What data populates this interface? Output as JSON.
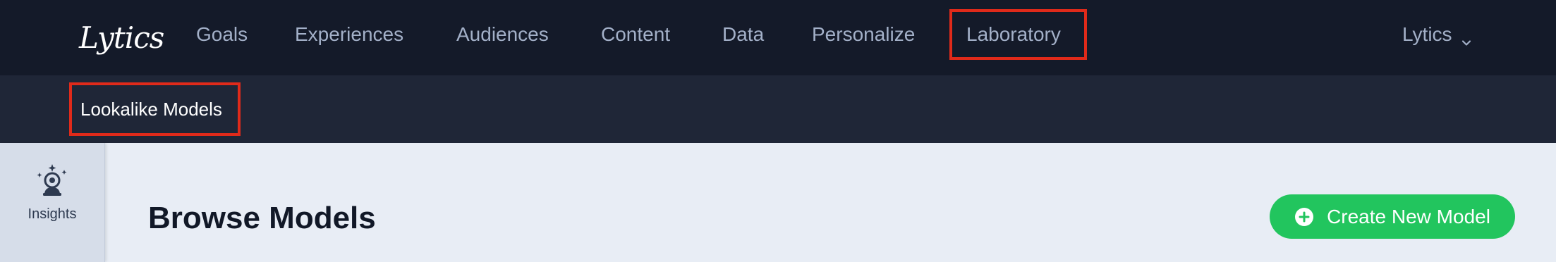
{
  "brand": {
    "logo_text": "Lytics"
  },
  "nav": {
    "items": [
      {
        "label": "Goals"
      },
      {
        "label": "Experiences"
      },
      {
        "label": "Audiences"
      },
      {
        "label": "Content"
      },
      {
        "label": "Data"
      },
      {
        "label": "Personalize"
      },
      {
        "label": "Laboratory",
        "active": true
      }
    ],
    "account_label": "Lytics",
    "account_icon": "chevron-down-icon"
  },
  "subnav": {
    "items": [
      {
        "label": "Lookalike Models",
        "active": true
      }
    ]
  },
  "sidebar": {
    "items": [
      {
        "label": "Insights",
        "icon": "crystal-ball-icon"
      }
    ]
  },
  "main": {
    "title": "Browse Models",
    "create_button_label": "Create New Model",
    "create_button_icon": "plus-circle-icon"
  },
  "colors": {
    "nav_bg": "#141a29",
    "subnav_bg": "#1f2637",
    "highlight": "#e02a1a",
    "primary": "#22c55e",
    "content_bg": "#e8edf5"
  }
}
